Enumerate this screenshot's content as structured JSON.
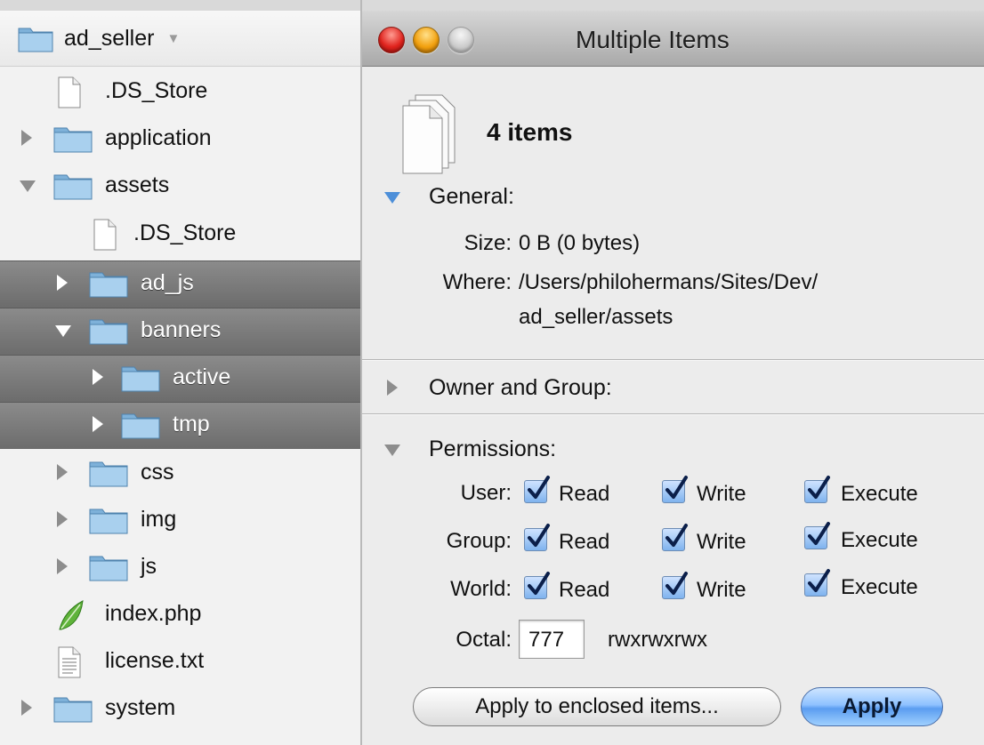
{
  "sidebar": {
    "project": {
      "name": "ad_seller"
    },
    "items": [
      {
        "label": ".DS_Store",
        "kind": "file",
        "depth": 0,
        "disclosure": "none",
        "selected": false
      },
      {
        "label": "application",
        "kind": "folder",
        "depth": 0,
        "disclosure": "closed",
        "selected": false
      },
      {
        "label": "assets",
        "kind": "folder",
        "depth": 0,
        "disclosure": "open",
        "selected": false
      },
      {
        "label": ".DS_Store",
        "kind": "file",
        "depth": 1,
        "disclosure": "none",
        "selected": false
      },
      {
        "label": "ad_js",
        "kind": "folder",
        "depth": 1,
        "disclosure": "closed",
        "selected": true
      },
      {
        "label": "banners",
        "kind": "folder",
        "depth": 1,
        "disclosure": "open",
        "selected": true
      },
      {
        "label": "active",
        "kind": "folder",
        "depth": 2,
        "disclosure": "closed",
        "selected": true
      },
      {
        "label": "tmp",
        "kind": "folder",
        "depth": 2,
        "disclosure": "closed",
        "selected": true
      },
      {
        "label": "css",
        "kind": "folder",
        "depth": 1,
        "disclosure": "closed",
        "selected": false
      },
      {
        "label": "img",
        "kind": "folder",
        "depth": 1,
        "disclosure": "closed",
        "selected": false
      },
      {
        "label": "js",
        "kind": "folder",
        "depth": 1,
        "disclosure": "closed",
        "selected": false
      },
      {
        "label": "index.php",
        "kind": "php",
        "depth": 0,
        "disclosure": "none",
        "selected": false
      },
      {
        "label": "license.txt",
        "kind": "text",
        "depth": 0,
        "disclosure": "none",
        "selected": false
      },
      {
        "label": "system",
        "kind": "folder",
        "depth": 0,
        "disclosure": "closed",
        "selected": false
      }
    ]
  },
  "info": {
    "title": "Multiple Items",
    "items_count": "4 items",
    "general": {
      "title": "General:",
      "size_key": "Size:",
      "size_value": "0 B (0 bytes)",
      "where_key": "Where:",
      "where_line1": "/Users/philohermans/Sites/Dev/",
      "where_line2": "ad_seller/assets"
    },
    "owner_group": {
      "title": "Owner and Group:"
    },
    "permissions": {
      "title": "Permissions:",
      "rows": [
        {
          "label": "User:",
          "read": "Read",
          "write": "Write",
          "execute": "Execute"
        },
        {
          "label": "Group:",
          "read": "Read",
          "write": "Write",
          "execute": "Execute"
        },
        {
          "label": "World:",
          "read": "Read",
          "write": "Write",
          "execute": "Execute"
        }
      ],
      "octal_label": "Octal:",
      "octal_value": "777",
      "symbolic": "rwxrwxrwx"
    },
    "buttons": {
      "apply_enclosed": "Apply to enclosed items...",
      "apply": "Apply"
    }
  },
  "colors": {
    "selection": "#7a7a7a",
    "folder": "#9cc7e8",
    "checkbox": "#7fb3ee",
    "default_button": "#5b9df0"
  }
}
